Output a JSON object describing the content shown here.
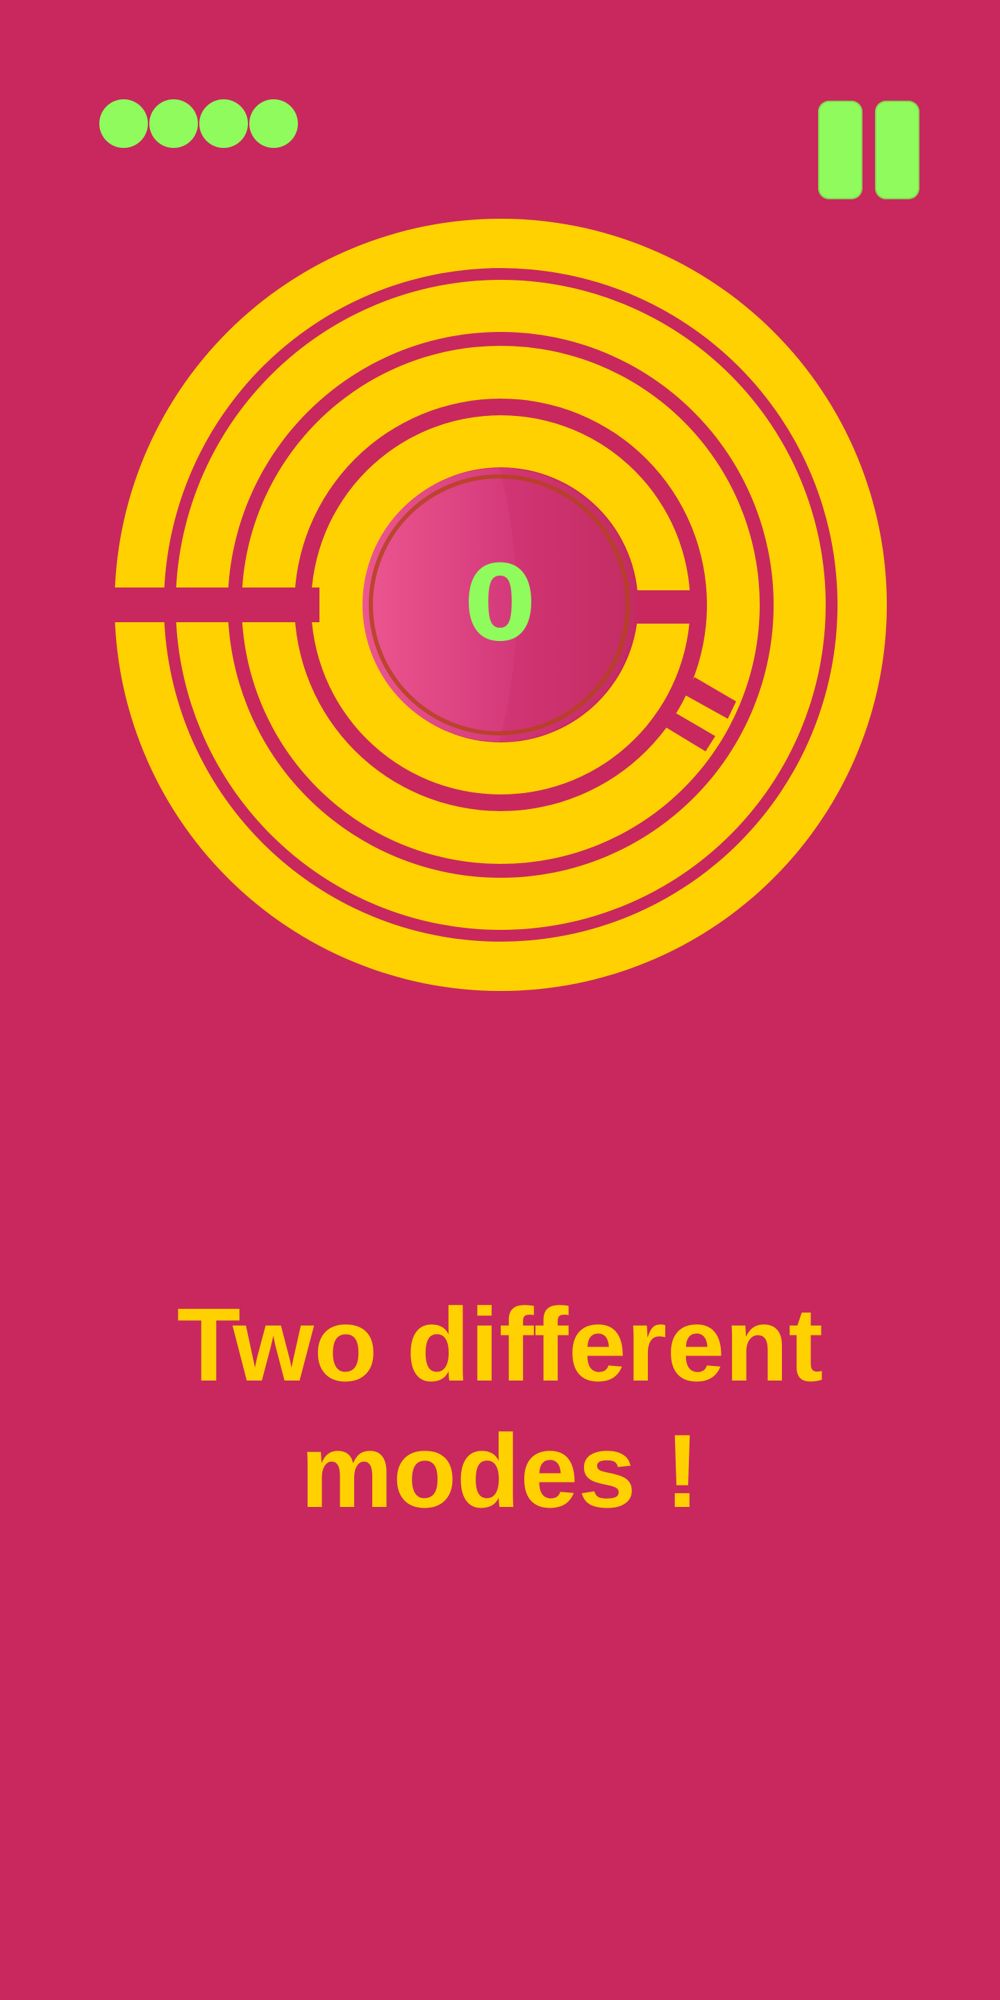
{
  "hud": {
    "lives": 4,
    "pause_icon": "pause-icon"
  },
  "game": {
    "score": "0",
    "ball_icon": "ball-icon"
  },
  "caption": {
    "line1": "Two different",
    "line2": "modes !"
  },
  "colors": {
    "background": "#C8285E",
    "maze": "#FFD100",
    "accent": "#8FFB5C",
    "ball": "#D9407A",
    "ball_ring": "#B5421E"
  }
}
